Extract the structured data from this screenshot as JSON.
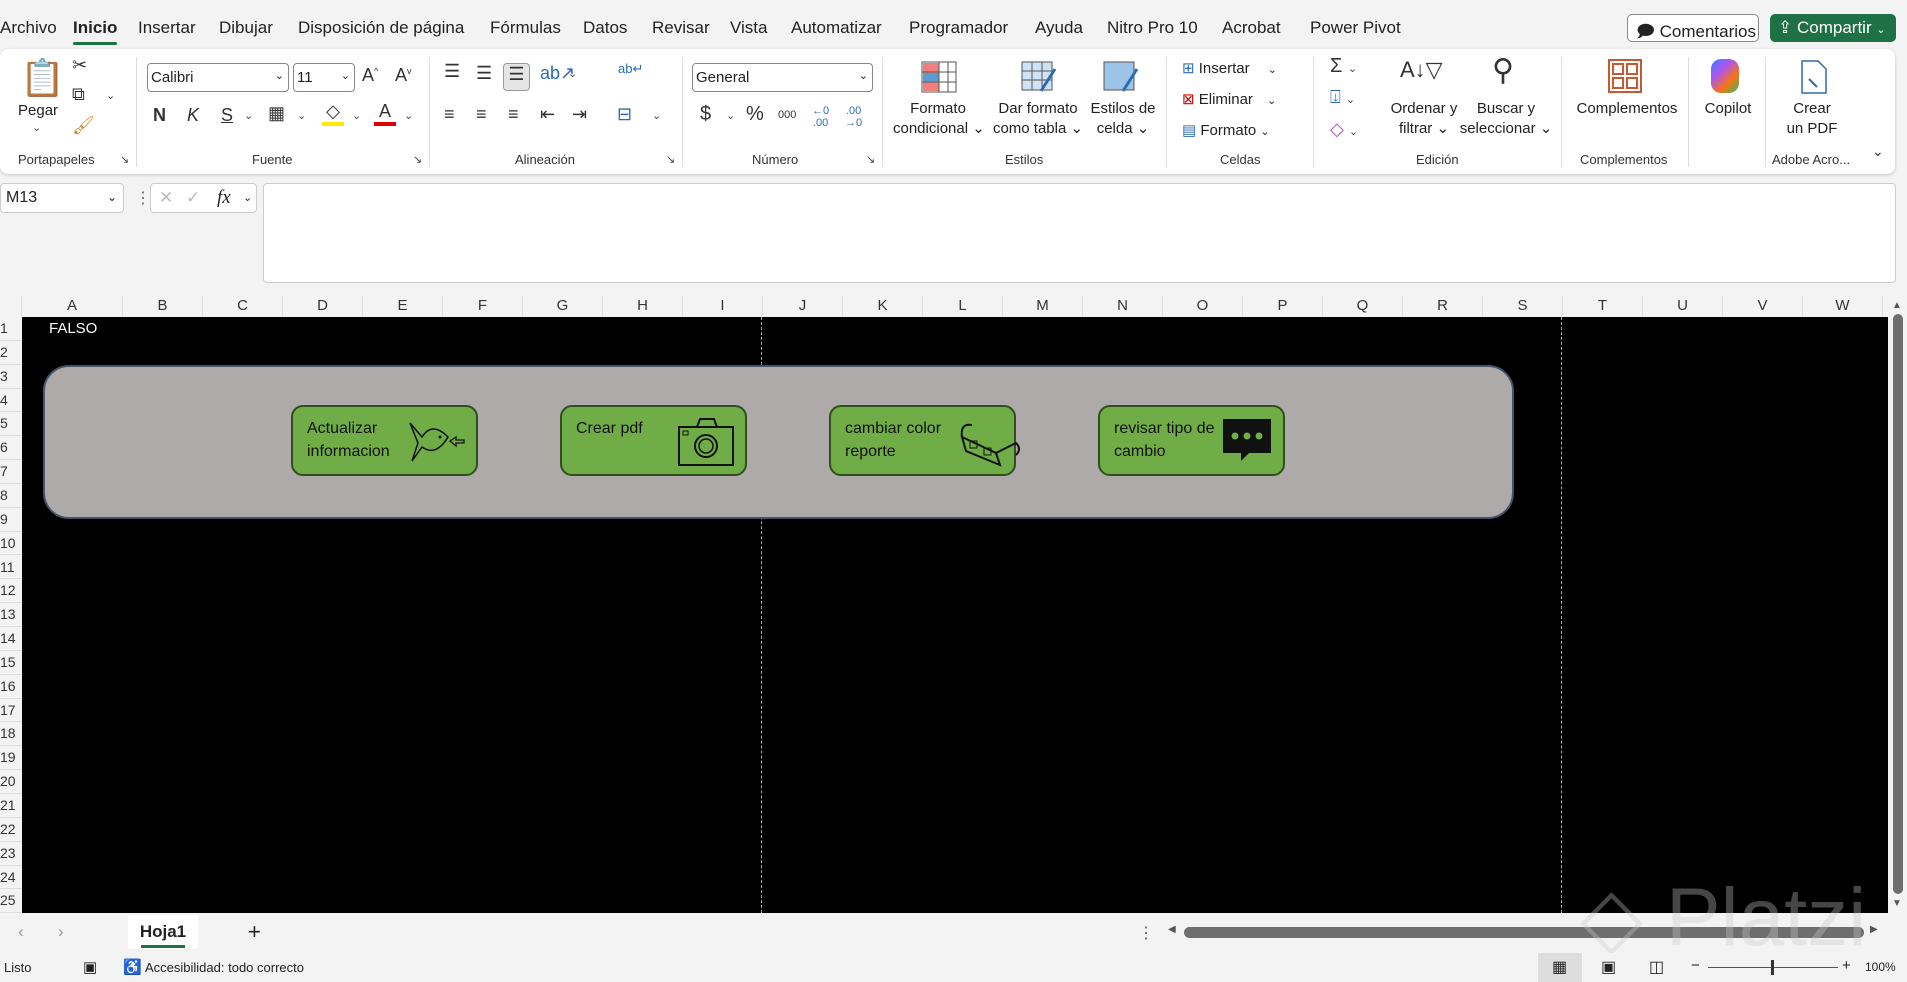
{
  "menu": {
    "tabs": [
      "Archivo",
      "Inicio",
      "Insertar",
      "Dibujar",
      "Disposición de página",
      "Fórmulas",
      "Datos",
      "Revisar",
      "Vista",
      "Automatizar",
      "Programador",
      "Ayuda",
      "Nitro Pro 10",
      "Acrobat",
      "Power Pivot"
    ],
    "active": "Inicio",
    "comments_label": "Comentarios",
    "share_label": "Compartir"
  },
  "ribbon": {
    "clipboard": {
      "paste": "Pegar",
      "group": "Portapapeles"
    },
    "font": {
      "name": "Calibri",
      "size": "11",
      "bold": "N",
      "italic": "K",
      "underline": "S",
      "group": "Fuente"
    },
    "alignment": {
      "group": "Alineación"
    },
    "number": {
      "format": "General",
      "currency": "$",
      "percent": "%",
      "thousands": "000",
      "group": "Número"
    },
    "styles": {
      "conditional": [
        "Formato",
        "condicional"
      ],
      "table": [
        "Dar formato",
        "como tabla"
      ],
      "cell": [
        "Estilos de",
        "celda"
      ],
      "group": "Estilos"
    },
    "cells": {
      "insert": "Insertar",
      "delete": "Eliminar",
      "format": "Formato",
      "group": "Celdas"
    },
    "editing": {
      "sort": [
        "Ordenar y",
        "filtrar"
      ],
      "find": [
        "Buscar y",
        "seleccionar"
      ],
      "group": "Edición"
    },
    "addins": {
      "label": "Complementos",
      "group": "Complementos"
    },
    "copilot": {
      "label": "Copilot"
    },
    "adobe": {
      "label": [
        "Crear",
        "un PDF"
      ],
      "group": "Adobe Acro..."
    }
  },
  "formula_bar": {
    "name_box": "M13",
    "fx": "fx",
    "value": ""
  },
  "sheet": {
    "columns": [
      "A",
      "B",
      "C",
      "D",
      "E",
      "F",
      "G",
      "H",
      "I",
      "J",
      "K",
      "L",
      "M",
      "N",
      "O",
      "P",
      "Q",
      "R",
      "S",
      "T",
      "U",
      "V",
      "W"
    ],
    "rows": [
      "1",
      "2",
      "3",
      "4",
      "5",
      "6",
      "7",
      "8",
      "9",
      "10",
      "11",
      "12",
      "13",
      "14",
      "15",
      "16",
      "17",
      "18",
      "19",
      "20",
      "21",
      "22",
      "23",
      "24",
      "25"
    ],
    "cell_A1": "FALSO",
    "buttons": [
      {
        "label": [
          "Actualizar",
          "informacion"
        ],
        "icon": "fish-icon"
      },
      {
        "label": [
          "Crear pdf",
          ""
        ],
        "icon": "camera-icon"
      },
      {
        "label": [
          "cambiar color",
          "reporte"
        ],
        "icon": "3d-glasses-icon"
      },
      {
        "label": [
          "revisar tipo de",
          "cambio"
        ],
        "icon": "chat-bubble-icon"
      }
    ],
    "colors": {
      "background": "#000000",
      "panel": "#aeaaaa",
      "button": "#70ad47"
    }
  },
  "sheet_tabs": {
    "tabs": [
      "Hoja1"
    ],
    "active": "Hoja1"
  },
  "status": {
    "ready": "Listo",
    "accessibility": "Accesibilidad: todo correcto",
    "zoom": "100%"
  },
  "watermark": "Platzi"
}
